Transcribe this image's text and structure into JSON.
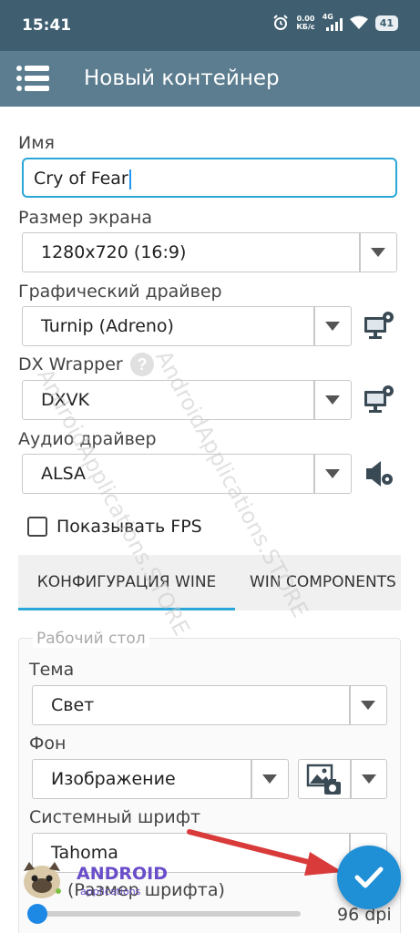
{
  "status": {
    "time": "15:41",
    "net_speed_value": "0.00",
    "net_speed_unit": "КБ/с",
    "signal_label": "4G",
    "battery": "41"
  },
  "appbar": {
    "title": "Новый контейнер"
  },
  "form": {
    "name_label": "Имя",
    "name_value": "Cry of Fear",
    "screen_label": "Размер экрана",
    "screen_value": "1280x720 (16:9)",
    "gpu_label": "Графический драйвер",
    "gpu_value": "Turnip (Adreno)",
    "dx_label": "DX Wrapper",
    "dx_help": "?",
    "dx_value": "DXVK",
    "audio_label": "Аудио драйвер",
    "audio_value": "ALSA",
    "fps_label": "Показывать FPS",
    "fps_checked": false
  },
  "tabs": [
    {
      "label": "КОНФИГУРАЦИЯ WINE",
      "active": true
    },
    {
      "label": "WIN COMPONENTS",
      "active": false
    }
  ],
  "desktop": {
    "legend": "Рабочий стол",
    "theme_label": "Тема",
    "theme_value": "Свет",
    "background_label": "Фон",
    "background_value": "Изображение",
    "font_label": "Системный шрифт",
    "font_value": "Tahoma",
    "font_size_label": "(Размер шрифта)",
    "font_size_value": "96 dpi",
    "font_size_level": 0
  },
  "watermark": {
    "brand": "ANDROID",
    "sub": "applications",
    "diagonal": "AndroidApplications.STORE"
  },
  "colors": {
    "statusbar": "#3f5e70",
    "appbar": "#5b7d8f",
    "accent": "#2aa7d8",
    "fab": "#1f8fd6",
    "arrow": "#d93b3b"
  }
}
